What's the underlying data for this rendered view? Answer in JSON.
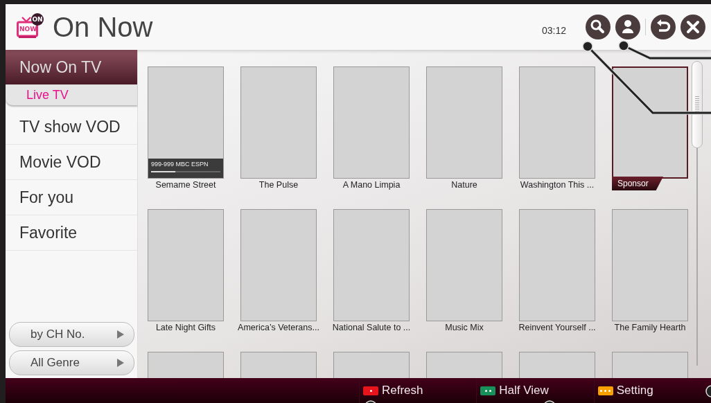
{
  "header": {
    "title": "On Now",
    "logo_badge": "ON",
    "logo_label": "NOW",
    "clock": "03:12"
  },
  "sidebar": {
    "items": [
      {
        "label": "Now On TV",
        "selected": true,
        "children": [
          {
            "label": "Live TV",
            "selected": true
          }
        ]
      },
      {
        "label": "TV show VOD",
        "selected": false
      },
      {
        "label": "Movie VOD",
        "selected": false
      },
      {
        "label": "For you",
        "selected": false
      },
      {
        "label": "Favorite",
        "selected": false
      }
    ],
    "filters": [
      {
        "label": "by CH No."
      },
      {
        "label": "All Genre"
      }
    ]
  },
  "tiles": [
    {
      "kind": "live",
      "title": "Semame Street",
      "channel": "999-999 MBC ESPN",
      "level": 0.35
    },
    {
      "kind": "plain",
      "title": "The Pulse"
    },
    {
      "kind": "plain",
      "title": "A Mano Limpia"
    },
    {
      "kind": "plain",
      "title": "Nature"
    },
    {
      "kind": "plain",
      "title": "Washington This ..."
    },
    {
      "kind": "sponsor",
      "badge": "Sponsor"
    },
    {
      "kind": "plain",
      "title": "Late Night Gifts"
    },
    {
      "kind": "plain",
      "title": "America’s Veterans..."
    },
    {
      "kind": "plain",
      "title": "National Salute to ..."
    },
    {
      "kind": "plain",
      "title": "Music Mix"
    },
    {
      "kind": "plain",
      "title": "Reinvent Yourself ..."
    },
    {
      "kind": "plain",
      "title": "The Family Hearth"
    },
    {
      "kind": "blank"
    },
    {
      "kind": "blank"
    },
    {
      "kind": "blank"
    },
    {
      "kind": "blank"
    },
    {
      "kind": "blank"
    },
    {
      "kind": "blank"
    }
  ],
  "bottom_bar": [
    {
      "label": "Refresh",
      "color": "#e8141c"
    },
    {
      "label": "Half View",
      "color": "#17905a"
    },
    {
      "label": "Setting",
      "color": "#f7a000"
    }
  ]
}
